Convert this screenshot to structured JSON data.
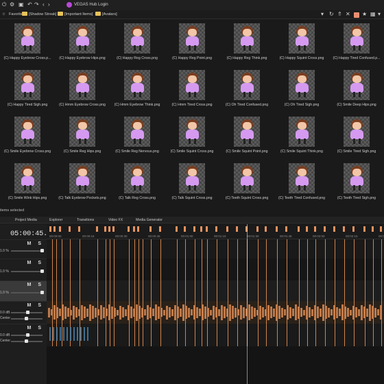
{
  "window": {
    "title": "VEGAS Hub Login",
    "colors": {
      "accent": "#e8935f",
      "logo": "#b84ad8",
      "background": "#1a1a1a"
    }
  },
  "favorites": {
    "items": [
      "Favorites",
      "[Shadow Streak]",
      "[Important Items]",
      "[Avatars]"
    ]
  },
  "files": [
    "(C) Happy Eyebrow Cross.p...",
    "(C) Happy Eyebrow Hips.png",
    "(C) Happy Reg Cross.png",
    "(C) Happy Reg Point.png",
    "(C) Happy Reg Think.png",
    "(C) Happy Squint Cross.png",
    "(C) Happy Tired Confused.p...",
    "(C) Happy Tired Sigh.png",
    "(C) Hmm Eyebrow Cross.png",
    "(C) Hmm Eyebrow Think.png",
    "(C) Hmm Tired Cross.png",
    "(C) Oh Tired Confused.png",
    "(C) Oh Tired Sigh.png",
    "(C) Smile Deep Hips.png",
    "(C) Smile Eyebrow Cross.png",
    "(C) Smile Reg Hips.png",
    "(C) Smile Reg Nervous.png",
    "(C) Smile Squint Cross.png",
    "(C) Smile Squint Point.png",
    "(C) Smile Squint Think.png",
    "(C) Smile Tired Sigh.png",
    "(C) Smile Wink Hips.png",
    "(C) Talk Eyebrow Pockets.png",
    "(C) Talk Reg Cross.png",
    "(C) Talk Squint Cross.png",
    "(C) Teeth Squint Cross.png",
    "(C) Teeth Tired Confused.png",
    "(C) Teeth Tired Sigh.png"
  ],
  "status": "items selected",
  "tabs": [
    "Project Media",
    "Explorer",
    "Transitions",
    "Video FX",
    "Media Generator"
  ],
  "timeline": {
    "timecode": "05:00:45.12",
    "tracks": [
      {
        "ms": "M S",
        "volume": "1.0 %",
        "pan": ""
      },
      {
        "ms": "M S",
        "volume": "1.0 %",
        "pan": ""
      },
      {
        "ms": "M S",
        "volume": "1.0 %",
        "pan": ""
      },
      {
        "ms": "M S",
        "volume": "0.0 dB",
        "pan": "Center"
      },
      {
        "ms": "M S",
        "volume": "0.0 dB",
        "pan": "Center"
      }
    ],
    "ruler_ticks": [
      "00:00:00",
      "00:00:15",
      "00:00:30",
      "00:00:45",
      "00:01:00",
      "00:01:15",
      "00:01:30",
      "00:01:45",
      "00:02:00",
      "00:02:15",
      "00:02:30"
    ]
  }
}
